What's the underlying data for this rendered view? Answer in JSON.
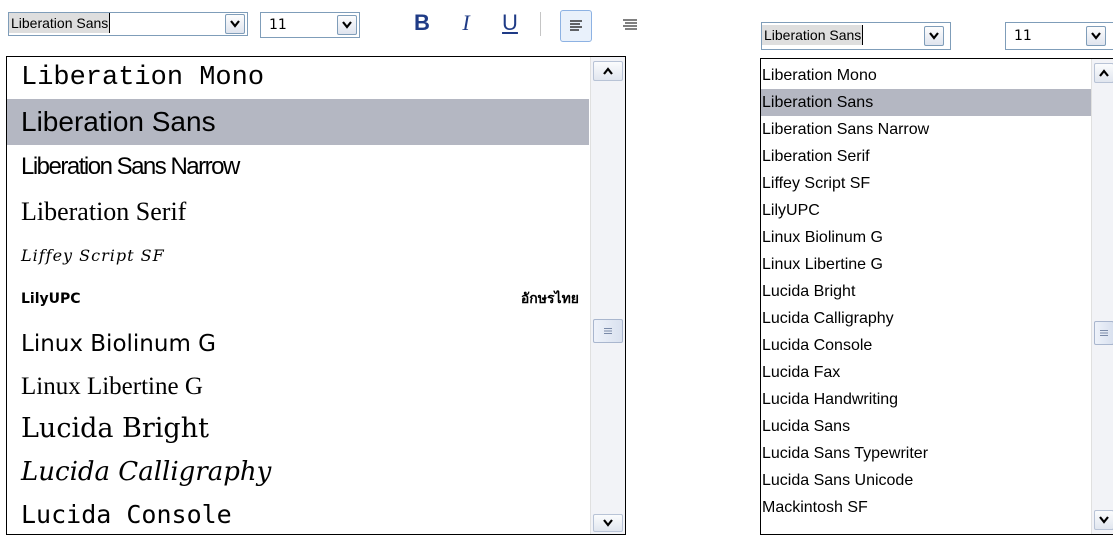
{
  "left_panel": {
    "toolbar": {
      "font_name": "Liberation Sans",
      "font_size": "11",
      "bold_label": "B",
      "italic_label": "I",
      "underline_label": "U"
    },
    "font_list": [
      {
        "label": "Liberation Mono"
      },
      {
        "label": "Liberation Sans",
        "selected": true
      },
      {
        "label": "Liberation Sans Narrow"
      },
      {
        "label": "Liberation Serif"
      },
      {
        "label": "Liffey Script SF"
      },
      {
        "label": "LilyUPC",
        "preview_sample": "อักษรไทย"
      },
      {
        "label": "Linux Biolinum G"
      },
      {
        "label": "Linux Libertine G"
      },
      {
        "label": "Lucida Bright"
      },
      {
        "label": "Lucida Calligraphy"
      },
      {
        "label": "Lucida Console"
      }
    ]
  },
  "right_panel": {
    "toolbar": {
      "font_name": "Liberation Sans",
      "font_size": "11"
    },
    "font_list": [
      {
        "label": "Liberation Mono"
      },
      {
        "label": "Liberation Sans",
        "selected": true
      },
      {
        "label": "Liberation Sans Narrow"
      },
      {
        "label": "Liberation Serif"
      },
      {
        "label": "Liffey Script SF"
      },
      {
        "label": "LilyUPC"
      },
      {
        "label": "Linux Biolinum G"
      },
      {
        "label": "Linux Libertine G"
      },
      {
        "label": "Lucida Bright"
      },
      {
        "label": "Lucida Calligraphy"
      },
      {
        "label": "Lucida Console"
      },
      {
        "label": "Lucida Fax"
      },
      {
        "label": "Lucida Handwriting"
      },
      {
        "label": "Lucida Sans"
      },
      {
        "label": "Lucida Sans Typewriter"
      },
      {
        "label": "Lucida Sans Unicode"
      },
      {
        "label": "Mackintosh SF"
      }
    ]
  },
  "colors": {
    "selection": "#b4b7c2",
    "bold_underline": "#1f3b86",
    "border": "#7f9db9"
  }
}
